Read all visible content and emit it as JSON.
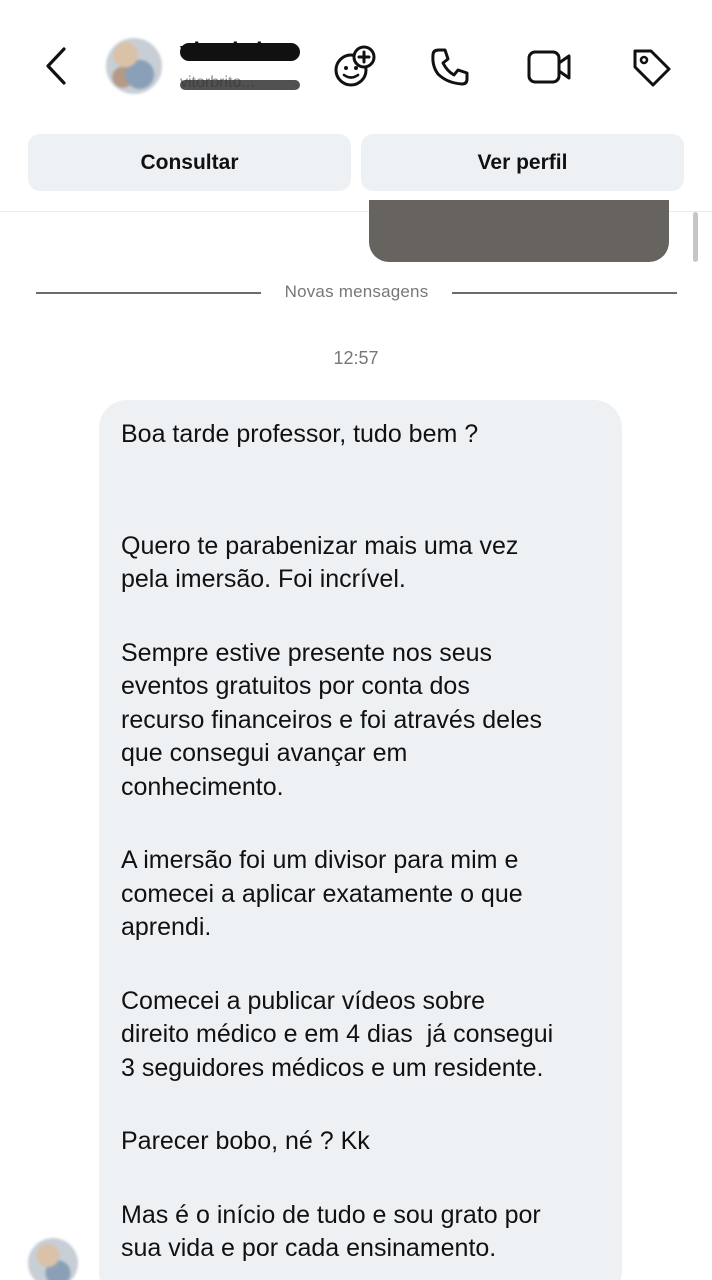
{
  "header": {
    "contact_name": "vitorbri...",
    "contact_handle": "vitorbrito...",
    "icons": {
      "back": "chevron-left-icon",
      "add_member": "add-person-icon",
      "call": "phone-icon",
      "video": "video-camera-icon",
      "tag": "tag-icon"
    }
  },
  "actions": {
    "consult_label": "Consultar",
    "profile_label": "Ver perfil"
  },
  "chat": {
    "new_messages_label": "Novas mensagens",
    "timestamp": "12:57",
    "message": {
      "greeting": "Boa tarde professor, tudo bem ?",
      "p1": [
        "Quero te parabenizar mais uma vez",
        "pela imersão. Foi incrível."
      ],
      "p2": [
        "Sempre estive presente nos seus",
        "eventos gratuitos por conta dos",
        "recurso financeiros e foi através deles",
        "que consegui avançar em",
        "conhecimento."
      ],
      "p3": [
        "A imersão foi um divisor para mim e",
        "comecei a aplicar exatamente o que",
        "aprendi."
      ],
      "p4": [
        "Comecei a publicar vídeos sobre",
        "direito médico e em 4 dias  já consegui",
        "3 seguidores médicos e um residente."
      ],
      "p5": "Parecer bobo, né ? Kk",
      "p6": [
        "Mas é o início de tudo e sou grato por",
        "sua vida e por cada ensinamento."
      ]
    }
  },
  "colors": {
    "bubble_bg": "#eef1f4",
    "button_bg": "#eef1f4",
    "media_bg": "#67635f"
  }
}
